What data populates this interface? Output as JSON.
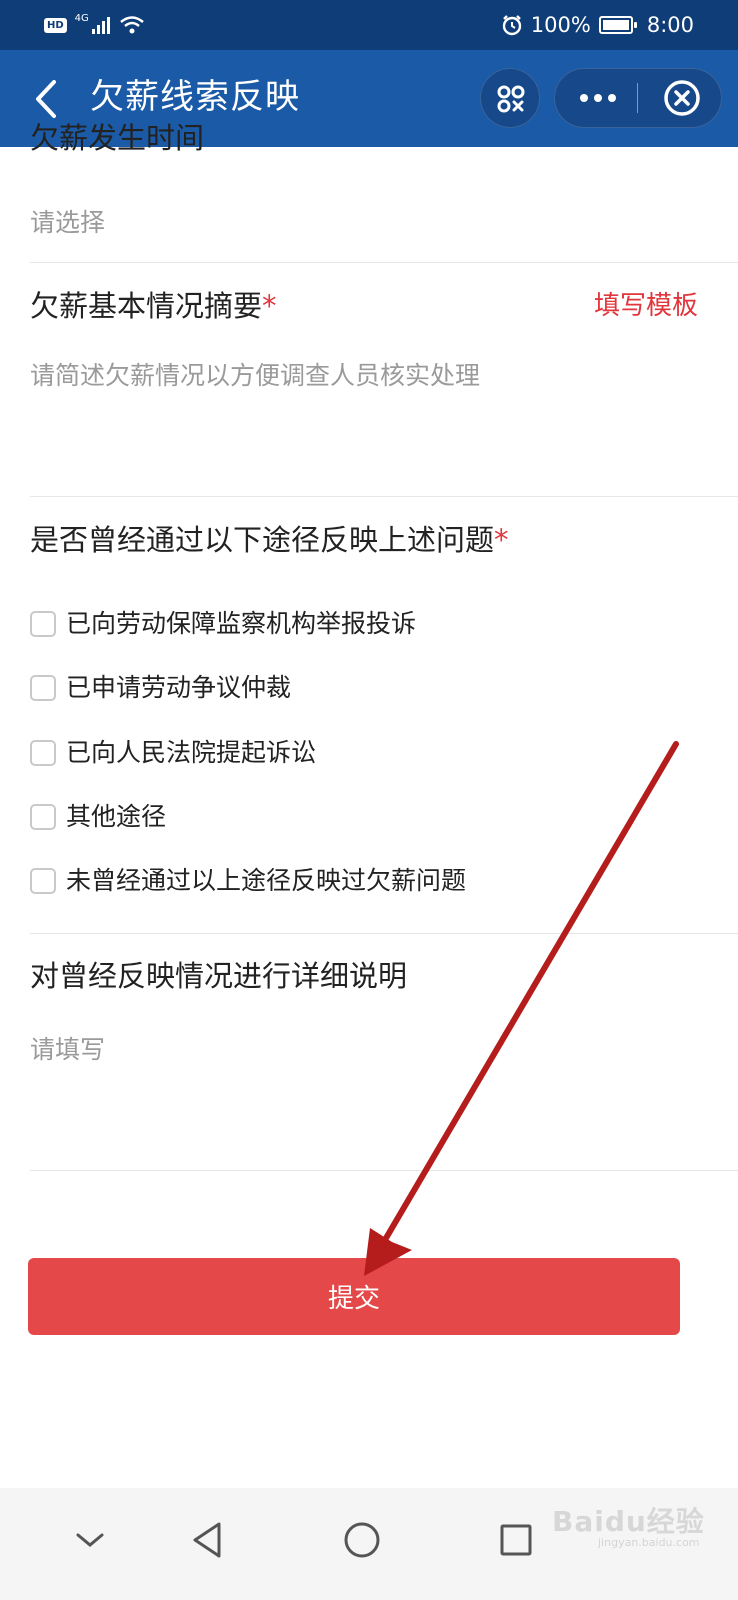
{
  "status_bar": {
    "hd": "HD",
    "network": "4G",
    "battery_percent": "100%",
    "time": "8:00",
    "icons": [
      "signal-icon",
      "wifi-icon",
      "alarm-icon",
      "battery-charging-icon"
    ]
  },
  "nav": {
    "title": "欠薪线索反映",
    "icons": [
      "back-icon",
      "scan-icon",
      "more-icon",
      "close-icon"
    ]
  },
  "form": {
    "date_field": {
      "label_partial": "欠薪发生时间",
      "placeholder": "请选择"
    },
    "summary_field": {
      "label": "欠薪基本情况摘要",
      "required_mark": "*",
      "template_link": "填写模板",
      "placeholder": "请简述欠薪情况以方便调查人员核实处理"
    },
    "channels_field": {
      "label": "是否曾经通过以下途径反映上述问题",
      "required_mark": "*",
      "options": [
        {
          "label": "已向劳动保障监察机构举报投诉",
          "checked": false
        },
        {
          "label": "已申请劳动争议仲裁",
          "checked": false
        },
        {
          "label": "已向人民法院提起诉讼",
          "checked": false
        },
        {
          "label": "其他途径",
          "checked": false
        },
        {
          "label": "未曾经通过以上途径反映过欠薪问题",
          "checked": false
        }
      ]
    },
    "detail_field": {
      "label": "对曾经反映情况进行详细说明",
      "placeholder": "请填写"
    },
    "submit_label": "提交"
  },
  "system_nav": {
    "icons": [
      "chevron-down-icon",
      "back-triangle-icon",
      "home-circle-icon",
      "recents-square-icon"
    ]
  },
  "watermark": {
    "text": "Baidu经验",
    "sub": "jingyan.baidu.com"
  },
  "colors": {
    "status_bar": "#0f3d77",
    "nav_bar": "#1b5aa6",
    "required": "#e0363c",
    "submit": "#e54848",
    "annotation_arrow": "#b51c1c"
  }
}
